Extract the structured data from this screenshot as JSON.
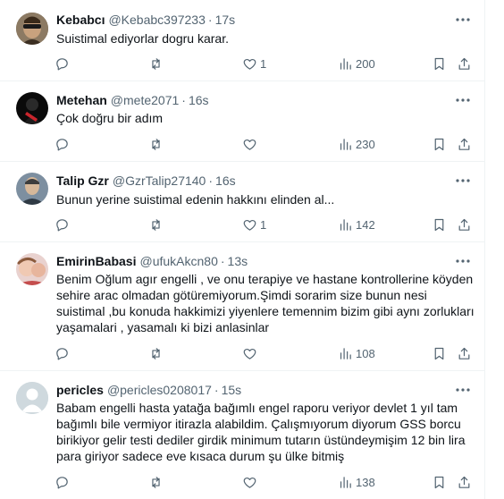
{
  "tweets": [
    {
      "name": "Kebabcı",
      "handle": "@Kebabc397233",
      "time": "17s",
      "text": "Suistimal ediyorlar dogru karar.",
      "likes": "1",
      "views": "200"
    },
    {
      "name": "Metehan",
      "handle": "@mete2071",
      "time": "16s",
      "text": "Çok doğru bir adım",
      "likes": "",
      "views": "230"
    },
    {
      "name": "Talip Gzr",
      "handle": "@GzrTalip27140",
      "time": "16s",
      "text": "Bunun yerine suistimal edenin hakkını elinden al...",
      "likes": "1",
      "views": "142"
    },
    {
      "name": "EmirinBabasi",
      "handle": "@ufukAkcn80",
      "time": "13s",
      "text": "Benim Oğlum agır engelli , ve onu terapiye ve hastane kontrollerine köyden sehire arac olmadan götüremiyorum.Şimdi sorarim size bunun nesi suistimal ,bu konuda hakkimizi yiyenlere temennim bizim gibi aynı zorlukları yaşamalari , yasamalı ki bizi anlasinlar",
      "likes": "",
      "views": "108"
    },
    {
      "name": "pericles",
      "handle": "@pericles0208017",
      "time": "15s",
      "text": "Babam engelli hasta yatağa bağımlı engel raporu veriyor devlet 1 yıl tam bağımlı bile vermiyor itirazla alabildim. Çalışmıyorum diyorum GSS borcu birikiyor gelir testi dediler girdik minimum tutarın üstündeymişim 12 bin lira para giriyor sadece eve kısaca durum şu ülke bitmiş",
      "likes": "",
      "views": "138"
    }
  ],
  "separator": "·",
  "icons": {
    "reply": "reply-icon",
    "retweet": "retweet-icon",
    "like": "heart-icon",
    "views": "views-icon",
    "bookmark": "bookmark-icon",
    "share": "share-icon",
    "more": "more-icon"
  },
  "colors": {
    "text": "#0f1419",
    "secondary": "#536471",
    "border": "#eff3f4"
  }
}
